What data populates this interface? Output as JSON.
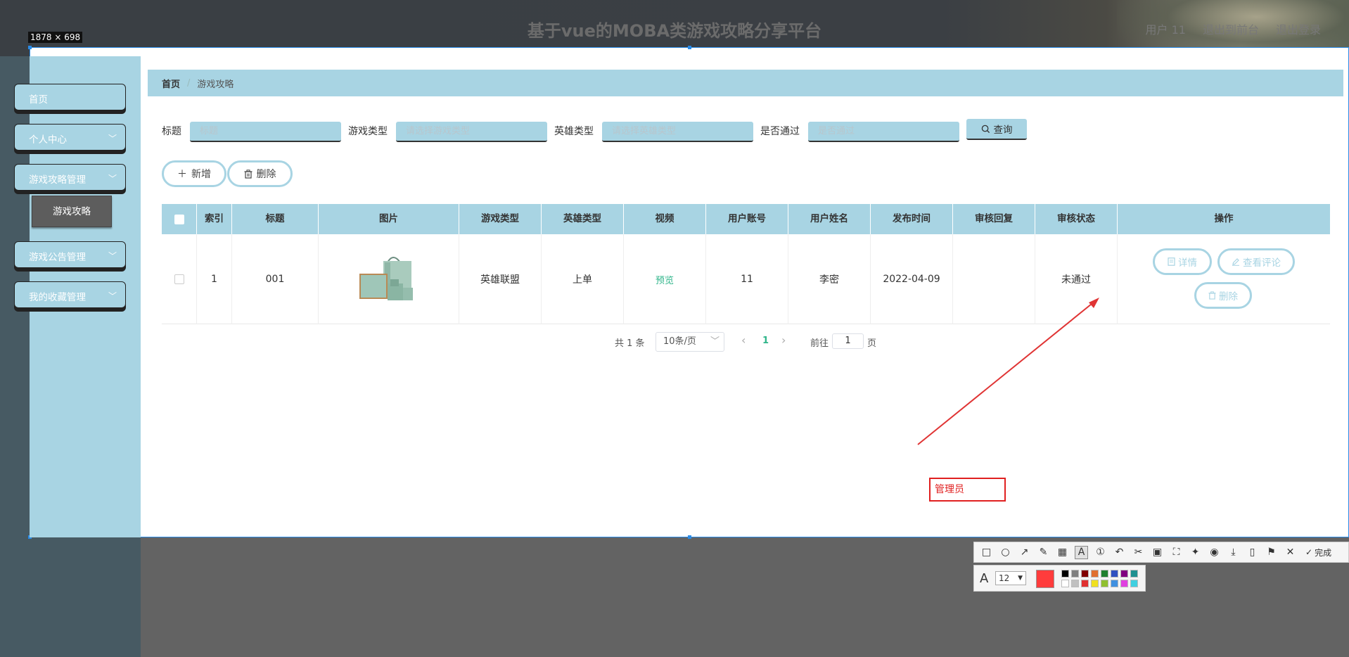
{
  "header": {
    "title": "基于vue的MOBA类游戏攻略分享平台",
    "links": [
      "用户 11",
      "退出到前台",
      "退出登录"
    ]
  },
  "capture": {
    "size_label": "1878 × 698"
  },
  "sidebar": {
    "items": [
      {
        "label": "首页",
        "has_chevron": false
      },
      {
        "label": "个人中心",
        "has_chevron": true
      },
      {
        "label": "游戏攻略管理",
        "has_chevron": true
      },
      {
        "label": "游戏公告管理",
        "has_chevron": true
      },
      {
        "label": "我的收藏管理",
        "has_chevron": true
      }
    ],
    "submenu": "游戏攻略",
    "chevron": "﹀"
  },
  "breadcrumb": {
    "home": "首页",
    "separator": "/",
    "current": "游戏攻略"
  },
  "search": {
    "fields": [
      {
        "label": "标题",
        "placeholder": "标题"
      },
      {
        "label": "游戏类型",
        "placeholder": "请选择游戏类型"
      },
      {
        "label": "英雄类型",
        "placeholder": "请选择英雄类型"
      },
      {
        "label": "是否通过",
        "placeholder": "是否通过"
      }
    ],
    "query_label": "查询"
  },
  "actions": {
    "add_label": "新增",
    "delete_label": "删除"
  },
  "table": {
    "headers": [
      "",
      "索引",
      "标题",
      "图片",
      "游戏类型",
      "英雄类型",
      "视频",
      "用户账号",
      "用户姓名",
      "发布时间",
      "审核回复",
      "审核状态",
      "操作"
    ],
    "rows": [
      {
        "index": "1",
        "title": "001",
        "game_type": "英雄联盟",
        "hero_type": "上单",
        "video": "预览",
        "account": "11",
        "name": "李密",
        "date": "2022-04-09",
        "reply": "",
        "status": "未通过",
        "ops": {
          "detail": "详情",
          "comments": "查看评论",
          "delete": "删除"
        }
      }
    ]
  },
  "pagination": {
    "total": "共 1 条",
    "page_size": "10条/页",
    "current_page": "1",
    "goto_label": "前往",
    "goto_value": "1",
    "page_suffix": "页",
    "prev": "‹",
    "next": "›"
  },
  "annotation": {
    "text": "管理员",
    "color": "#e02020"
  },
  "screenshot_tools": {
    "done_label": "完成",
    "font_size": "12",
    "current_color": "#ff3c3c",
    "palette_top": [
      "#000000",
      "#808080",
      "#800000",
      "#e07030",
      "#208030",
      "#3050c0",
      "#800080",
      "#209090"
    ],
    "palette_bottom": [
      "#ffffff",
      "#c0c0c0",
      "#e03030",
      "#f0e020",
      "#90c030",
      "#4090e0",
      "#e040e0",
      "#40d0e0"
    ]
  }
}
